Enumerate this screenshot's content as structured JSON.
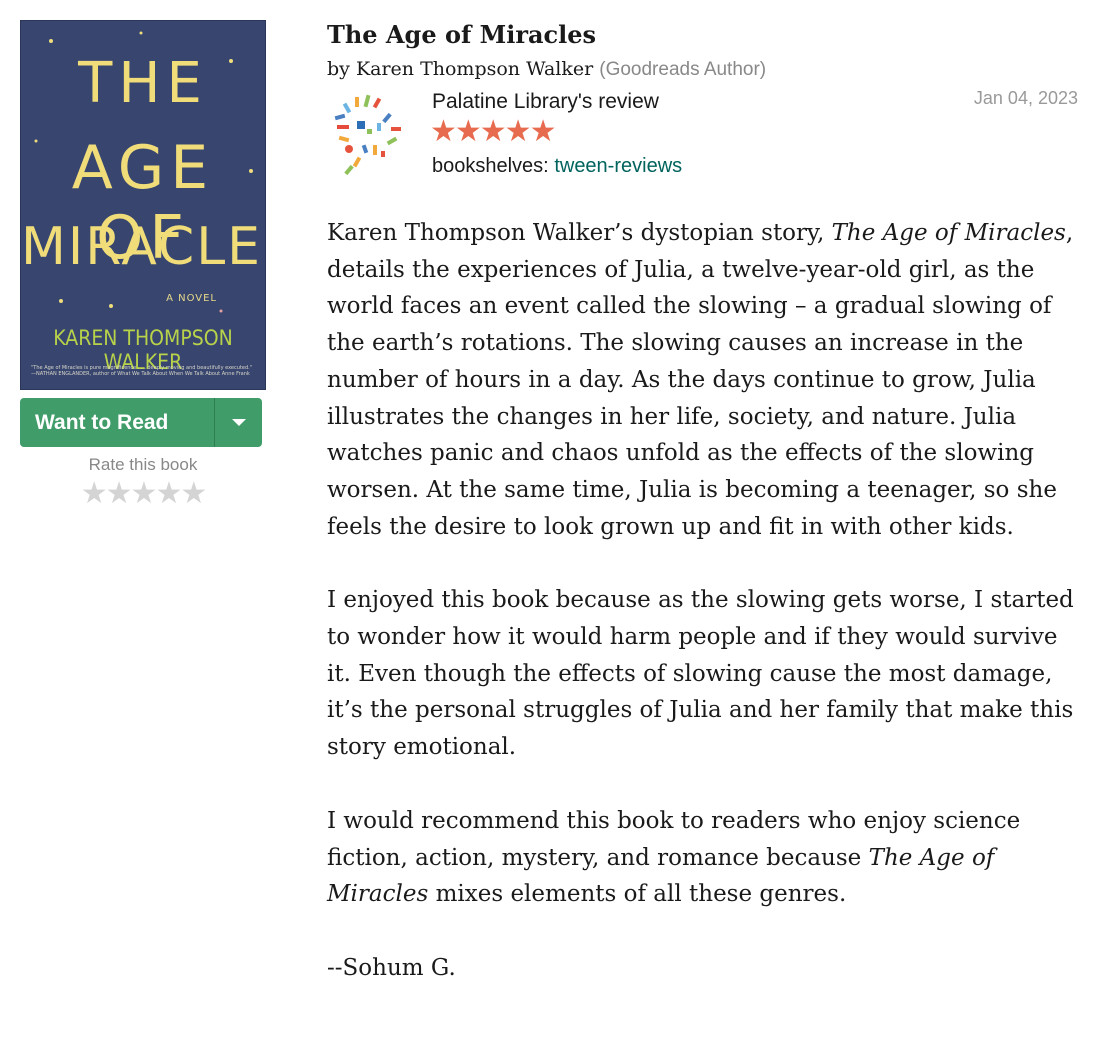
{
  "cover": {
    "title_line1": "THE",
    "title_line2": "AGE OF",
    "title_line3": "MIRACLES",
    "novel_label": "A NOVEL",
    "author": "KAREN THOMPSON WALKER",
    "quote": "\"The Age of Miracles is pure magnificence . . . deeply moving and beautifully executed.\" —NATHAN ENGLANDER, author of What We Talk About When We Talk About Anne Frank",
    "colors": {
      "background": "#37456f",
      "title": "#f0dd7a",
      "author": "#b8d24a"
    }
  },
  "shelf_button": {
    "label": "Want to Read",
    "dropdown_icon": "caret-down-icon",
    "color": "#409d69"
  },
  "rating_widget": {
    "label": "Rate this book",
    "stars": [
      "★",
      "★",
      "★",
      "★",
      "★"
    ],
    "star_icon": "star-outline-icon"
  },
  "book": {
    "title": "The Age of Miracles",
    "by_prefix": "by",
    "author": "Karen Thompson Walker",
    "author_role": "(Goodreads Author)"
  },
  "review": {
    "reviewer_avatar_icon": "palatine-library-logo",
    "reviewer": "Palatine Library's review",
    "rating": 5,
    "rating_stars": "★★★★★",
    "rating_color": "#e76b4e",
    "date": "Jan 04, 2023",
    "shelves_label": "bookshelves:",
    "shelf": "tween-reviews",
    "p1_a": "Karen Thompson Walker’s dystopian story, ",
    "p1_title": "The Age of Miracles",
    "p1_b": ", details the experiences of Julia, a twelve-year-old girl, as the world faces an event called the slowing – a gradual slowing of the earth’s rotations. The slowing causes an increase in the number of hours in a day. As the days continue to grow, Julia illustrates the changes in her life, society, and nature. Julia watches panic and chaos unfold as the effects of the slowing worsen. At the same time, Julia is becoming a teenager, so she feels the desire to look grown up and fit in with other kids.",
    "p2": "I enjoyed this book because as the slowing gets worse, I started to wonder how it would harm people and if they would survive it. Even though the effects of slowing cause the most damage, it’s the personal struggles of Julia and her family that make this story emotional.",
    "p3_a": "I would recommend this book to readers who enjoy science fiction, action, mystery, and romance because ",
    "p3_title": "The Age of Miracles",
    "p3_b": " mixes elements of all these genres.",
    "signature": "--Sohum G."
  }
}
